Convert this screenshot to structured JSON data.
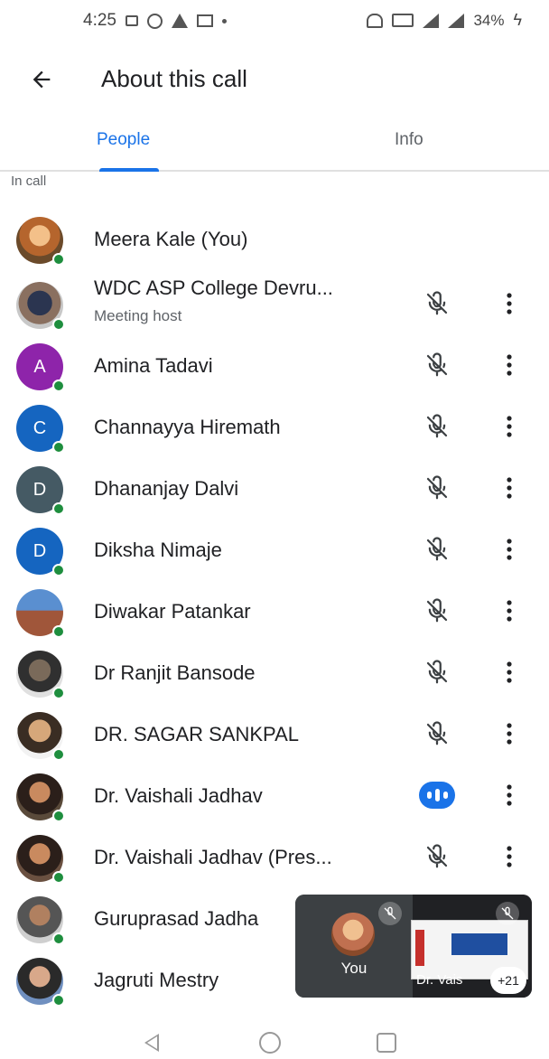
{
  "status_bar": {
    "time": "4:25",
    "battery": "34%",
    "icons": [
      "video-icon",
      "whatsapp-icon",
      "warning-icon",
      "gmail-icon",
      "dot-icon",
      "nfc-icon",
      "volte-icon",
      "signal-icon",
      "charging-icon"
    ]
  },
  "header": {
    "title": "About this call",
    "back_icon": "arrow-back-icon"
  },
  "tabs": [
    {
      "label": "People",
      "active": true
    },
    {
      "label": "Info",
      "active": false
    }
  ],
  "section_label": "In call",
  "participants": [
    {
      "name": "Meera Kale (You)",
      "subtitle": "",
      "avatar": "photo",
      "mic": "none"
    },
    {
      "name": "WDC ASP College Devru...",
      "subtitle": "Meeting host",
      "avatar": "photo",
      "mic": "muted"
    },
    {
      "name": "Amina Tadavi",
      "subtitle": "",
      "avatar": "A",
      "avatar_color": "#8e24aa",
      "mic": "muted"
    },
    {
      "name": "Channayya Hiremath",
      "subtitle": "",
      "avatar": "C",
      "avatar_color": "#1565c0",
      "mic": "muted"
    },
    {
      "name": "Dhananjay Dalvi",
      "subtitle": "",
      "avatar": "D",
      "avatar_color": "#455a64",
      "mic": "muted"
    },
    {
      "name": "Diksha Nimaje",
      "subtitle": "",
      "avatar": "D",
      "avatar_color": "#1565c0",
      "mic": "muted"
    },
    {
      "name": "Diwakar Patankar",
      "subtitle": "",
      "avatar": "photo",
      "mic": "muted"
    },
    {
      "name": "Dr Ranjit Bansode",
      "subtitle": "",
      "avatar": "photo",
      "mic": "muted"
    },
    {
      "name": "DR. SAGAR SANKPAL",
      "subtitle": "",
      "avatar": "photo",
      "mic": "muted"
    },
    {
      "name": "Dr. Vaishali Jadhav",
      "subtitle": "",
      "avatar": "photo",
      "mic": "speaking"
    },
    {
      "name": "Dr. Vaishali Jadhav (Pres...",
      "subtitle": "",
      "avatar": "photo",
      "mic": "muted"
    },
    {
      "name": "Guruprasad Jadha",
      "subtitle": "",
      "avatar": "photo",
      "mic": "hidden"
    },
    {
      "name": "Jagruti Mestry",
      "subtitle": "",
      "avatar": "photo",
      "mic": "hidden"
    }
  ],
  "preview": {
    "self_label": "You",
    "other_label": "Dr. Vais",
    "more_count": "+21"
  },
  "colors": {
    "accent": "#1a73e8",
    "presence": "#1e8e3e"
  }
}
